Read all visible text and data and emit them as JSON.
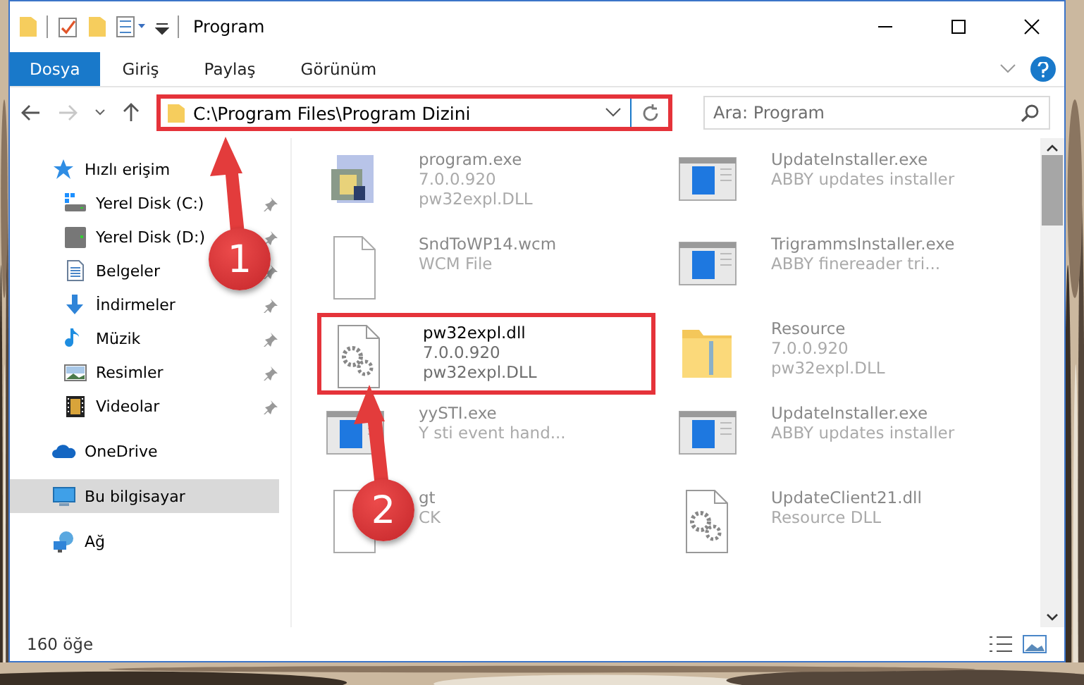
{
  "window": {
    "title": "Program"
  },
  "ribbon_tabs": [
    {
      "label": "Dosya",
      "kind": "file"
    },
    {
      "label": "Giriş",
      "kind": "tab"
    },
    {
      "label": "Paylaş",
      "kind": "tab"
    },
    {
      "label": "Görünüm",
      "kind": "tab"
    }
  ],
  "address": {
    "path": "C:\\Program Files\\Program Dizini",
    "highlighted": true
  },
  "search": {
    "placeholder": "Ara: Program"
  },
  "nav": [
    {
      "label": "Hızlı erişim",
      "kind": "star",
      "selected": false,
      "children": [
        {
          "label": "Yerel Disk (C:)",
          "kind": "windrive",
          "pinned": true,
          "selected": false
        },
        {
          "label": "Yerel Disk (D:)",
          "kind": "drive",
          "pinned": true,
          "selected": false
        },
        {
          "label": "Belgeler",
          "kind": "document",
          "pinned": true,
          "selected": false
        },
        {
          "label": "İndirmeler",
          "kind": "download",
          "pinned": true,
          "selected": false
        },
        {
          "label": "Müzik",
          "kind": "music",
          "pinned": true,
          "selected": false
        },
        {
          "label": "Resimler",
          "kind": "pictures",
          "pinned": true,
          "selected": false
        },
        {
          "label": "Videolar",
          "kind": "video",
          "pinned": true,
          "selected": false
        }
      ]
    },
    {
      "label": "OneDrive",
      "kind": "cloud",
      "selected": false
    },
    {
      "label": "Bu bilgisayar",
      "kind": "computer",
      "selected": true
    },
    {
      "label": "Ağ",
      "kind": "network",
      "selected": false
    }
  ],
  "files": [
    {
      "name": "program.exe",
      "details": [
        "7.0.0.920",
        "pw32expl.DLL"
      ],
      "kind": "program",
      "highlighted": false
    },
    {
      "name": "UpdateInstaller.exe",
      "details": [
        "ABBY updates installer"
      ],
      "kind": "window",
      "highlighted": false
    },
    {
      "name": "SndToWP14.wcm",
      "details": [
        "WCM File"
      ],
      "kind": "blank",
      "highlighted": false
    },
    {
      "name": "TrigrammsInstaller.exe",
      "details": [
        "ABBY finereader tri..."
      ],
      "kind": "window",
      "highlighted": false
    },
    {
      "name": "pw32expl.dll",
      "details": [
        "7.0.0.920",
        "pw32expl.DLL"
      ],
      "kind": "gears",
      "highlighted": true
    },
    {
      "name": "Resource",
      "details": [
        "7.0.0.920",
        "pw32expl.DLL"
      ],
      "kind": "folder",
      "highlighted": false
    },
    {
      "name": "yySTI.exe",
      "details": [
        "Y sti event hand..."
      ],
      "kind": "window",
      "highlighted": false
    },
    {
      "name": "UpdateInstaller.exe",
      "details": [
        "ABBY updates installer"
      ],
      "kind": "window",
      "highlighted": false
    },
    {
      "name": "gt",
      "details": [
        "CK"
      ],
      "kind": "blank",
      "highlighted": false
    },
    {
      "name": "UpdateClient21.dll",
      "details": [
        "Resource DLL"
      ],
      "kind": "gears",
      "highlighted": false
    }
  ],
  "annotations": [
    {
      "label": "1"
    },
    {
      "label": "2"
    }
  ],
  "status_bar": {
    "item_count": "160 öğe"
  }
}
